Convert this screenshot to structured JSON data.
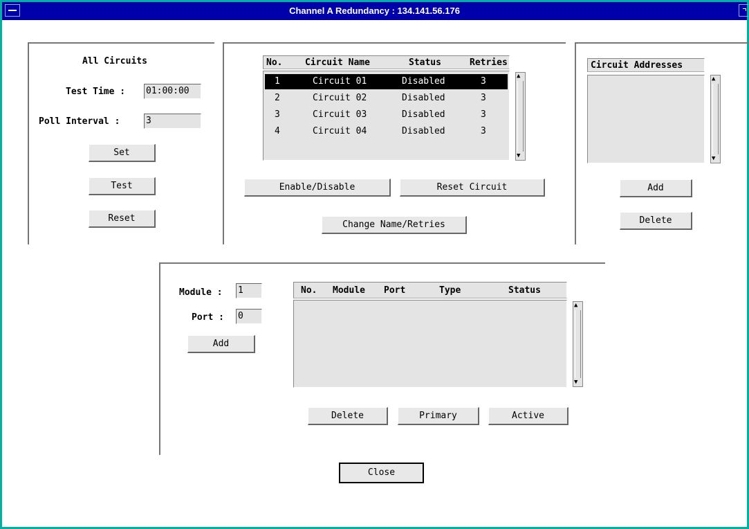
{
  "window": {
    "title": "Channel A Redundancy : 134.141.56.176"
  },
  "all_circuits": {
    "heading": "All Circuits",
    "test_time_label": "Test Time :",
    "test_time_value": "01:00:00",
    "poll_interval_label": "Poll Interval :",
    "poll_interval_value": "3",
    "set_label": "Set",
    "test_label": "Test",
    "reset_label": "Reset"
  },
  "circuits": {
    "columns": [
      "No.",
      "Circuit Name",
      "Status",
      "Retries"
    ],
    "rows": [
      {
        "no": "1",
        "name": "Circuit 01",
        "status": "Disabled",
        "retries": "3",
        "selected": true
      },
      {
        "no": "2",
        "name": "Circuit 02",
        "status": "Disabled",
        "retries": "3",
        "selected": false
      },
      {
        "no": "3",
        "name": "Circuit 03",
        "status": "Disabled",
        "retries": "3",
        "selected": false
      },
      {
        "no": "4",
        "name": "Circuit 04",
        "status": "Disabled",
        "retries": "3",
        "selected": false
      }
    ],
    "enable_disable_label": "Enable/Disable",
    "reset_circuit_label": "Reset Circuit",
    "change_name_label": "Change Name/Retries"
  },
  "addresses": {
    "heading": "Circuit Addresses",
    "add_label": "Add",
    "delete_label": "Delete"
  },
  "ports": {
    "module_label": "Module :",
    "module_value": "1",
    "port_label": "Port :",
    "port_value": "0",
    "add_label": "Add",
    "columns": [
      "No.",
      "Module",
      "Port",
      "Type",
      "Status"
    ],
    "delete_label": "Delete",
    "primary_label": "Primary",
    "active_label": "Active"
  },
  "close_label": "Close",
  "icons": {
    "menu": "window-menu-icon",
    "maximize": "maximize-icon"
  }
}
